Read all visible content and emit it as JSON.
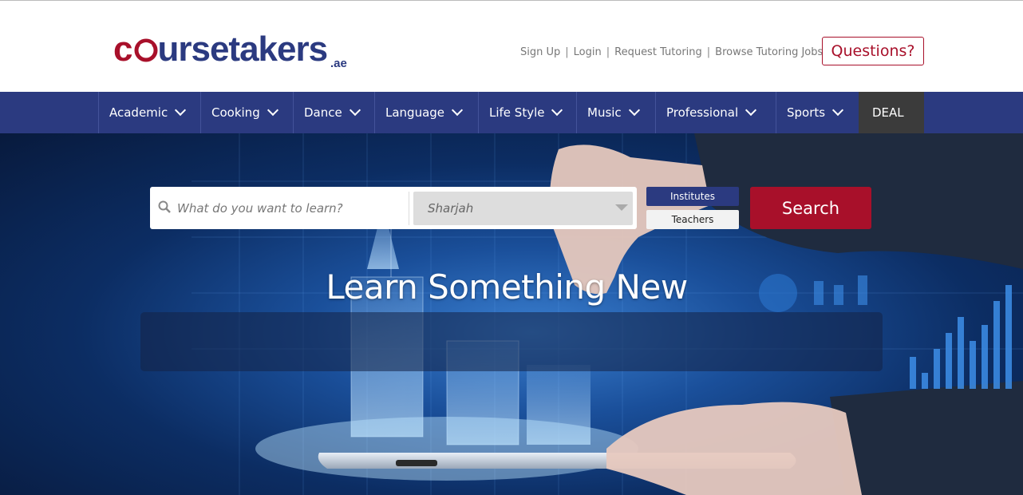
{
  "brand": {
    "name_first": "c",
    "name_rest": "ursetakers",
    "tld": ".ae",
    "colors": {
      "red": "#a8102a",
      "blue": "#2b3a80"
    }
  },
  "top_links": [
    {
      "label": "Sign Up"
    },
    {
      "label": "Login"
    },
    {
      "label": "Request Tutoring"
    },
    {
      "label": "Browse Tutoring Jobs"
    }
  ],
  "questions_label": "Questions?",
  "nav": {
    "items": [
      {
        "label": "Academic"
      },
      {
        "label": "Cooking"
      },
      {
        "label": "Dance"
      },
      {
        "label": "Language"
      },
      {
        "label": "Life Style"
      },
      {
        "label": "Music"
      },
      {
        "label": "Professional"
      },
      {
        "label": "Sports"
      }
    ],
    "deal_label": "DEAL"
  },
  "hero": {
    "title": "Learn Something New",
    "search": {
      "placeholder": "What do you want to learn?",
      "city_selected": "Sharjah",
      "toggle_institutes": "Institutes",
      "toggle_teachers": "Teachers",
      "button_label": "Search"
    }
  }
}
